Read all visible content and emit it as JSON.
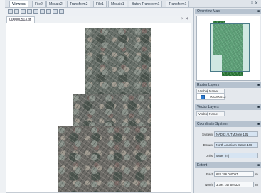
{
  "top_tabs": [
    {
      "label": "Viewers"
    },
    {
      "label": "File2"
    },
    {
      "label": "Mosaic2"
    },
    {
      "label": "Transform2"
    },
    {
      "label": "File1"
    },
    {
      "label": "Mosaic1"
    },
    {
      "label": "Batch Transform1"
    },
    {
      "label": "Transform1"
    }
  ],
  "window_controls": "× ✕",
  "document": {
    "tab_label": "000000513.tif",
    "controls": "× ✕"
  },
  "overview": {
    "title": "Overview Map"
  },
  "raster_layers": {
    "title": "Raster Layers",
    "columns": [
      "Visible",
      "Name"
    ],
    "rows": [
      {
        "visible": true,
        "name": "000000513"
      }
    ]
  },
  "vector_layers": {
    "title": "Vector Layers",
    "columns": [
      "Visible",
      "Name"
    ]
  },
  "coordinate_system": {
    "title": "Coordinate System",
    "fields": [
      {
        "label": "System",
        "value": "NAD83 / UTM zone 14N"
      },
      {
        "label": "Datum",
        "value": "North American Datum 198"
      },
      {
        "label": "Units",
        "value": "Meter (m)"
      }
    ]
  },
  "extent": {
    "title": "Extent",
    "fields": [
      {
        "label": "East",
        "value": "624 396.050097",
        "unit": "m"
      },
      {
        "label": "North",
        "value": "3 394 147.594329",
        "unit": "m"
      }
    ]
  },
  "colors": {
    "accent": "#2e7bd1",
    "panel_header": "#b6c2cf",
    "overview_image": "#2f7a3c"
  }
}
